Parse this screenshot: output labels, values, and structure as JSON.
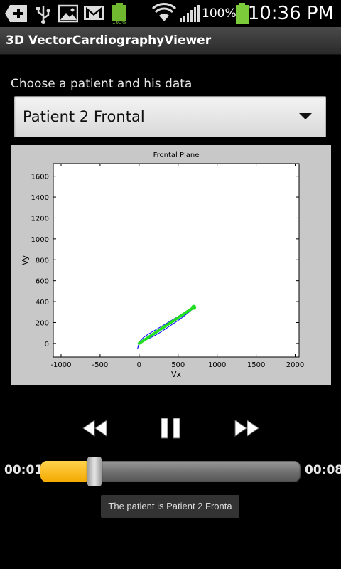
{
  "status_bar": {
    "battery_percent": "100%",
    "time": "10:36 PM",
    "notification_icons": [
      "add-icon",
      "usb-icon",
      "gallery-icon",
      "gmail-icon",
      "battery-full-icon"
    ],
    "colors": {
      "battery": "#7ccb3a"
    }
  },
  "app": {
    "title": "3D VectorCardiographyViewer"
  },
  "patient_selector": {
    "label": "Choose a patient and his data",
    "selected": "Patient 2 Frontal"
  },
  "chart_data": {
    "type": "line",
    "title": "Frontal Plane",
    "xlabel": "Vx",
    "ylabel": "Vy",
    "xlim": [
      -1100,
      2050
    ],
    "ylim": [
      -130,
      1720
    ],
    "xticks": [
      -1000,
      -500,
      0,
      500,
      1000,
      1500,
      2000
    ],
    "yticks": [
      0,
      200,
      400,
      600,
      800,
      1000,
      1200,
      1400,
      1600
    ],
    "grid": false,
    "series": [
      {
        "color": "#0000ff",
        "x": [
          0,
          20,
          60,
          120,
          200,
          280,
          360,
          440,
          520,
          590,
          650,
          690,
          700,
          690,
          640,
          560,
          470,
          380,
          290,
          200,
          120,
          60,
          20,
          0,
          -10,
          -20,
          -10,
          0
        ],
        "y": [
          0,
          10,
          25,
          45,
          75,
          110,
          150,
          190,
          230,
          270,
          305,
          330,
          345,
          340,
          320,
          285,
          245,
          205,
          165,
          125,
          90,
          60,
          30,
          10,
          -30,
          -50,
          -20,
          0
        ]
      },
      {
        "color": "#22dd22",
        "x": [
          0,
          700
        ],
        "y": [
          0,
          345
        ]
      }
    ]
  },
  "player": {
    "elapsed": "00:01",
    "total": "00:08",
    "progress": 0.125,
    "buttons": [
      "rewind-icon",
      "pause-icon",
      "fast-forward-icon"
    ]
  },
  "toast": {
    "text": "The patient is Patient 2 Fronta"
  }
}
